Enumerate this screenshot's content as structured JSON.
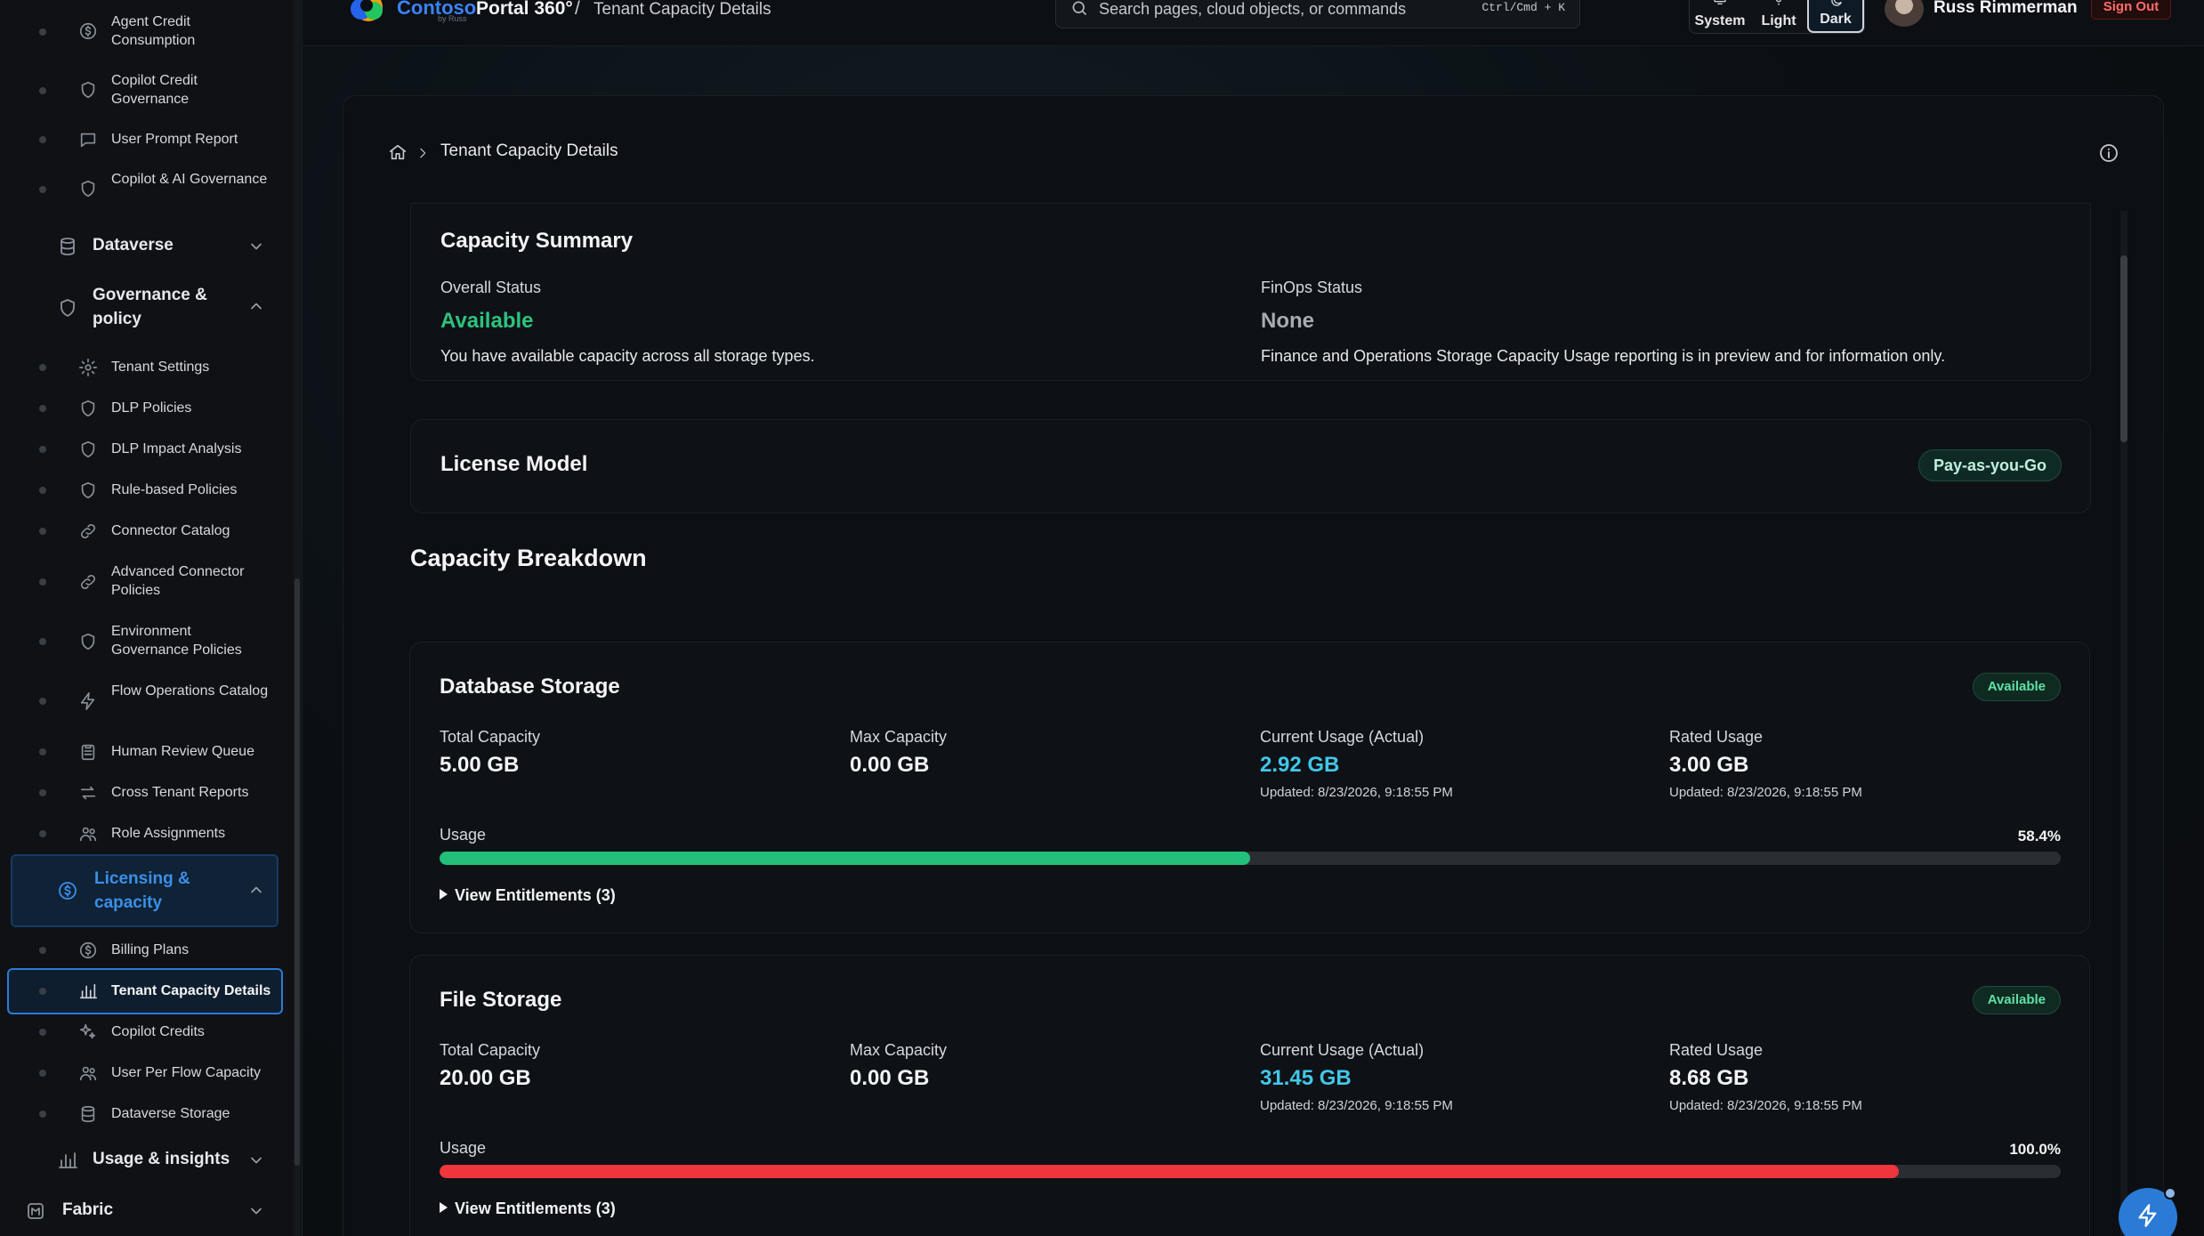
{
  "header": {
    "brand": "Contoso",
    "brand_sub": "by Russ",
    "app_title": "Portal 360°",
    "crumb_sep": "/",
    "page_title": "Tenant Capacity Details",
    "search_placeholder": "Search pages, cloud objects, or commands",
    "search_shortcut": "Ctrl/Cmd + K",
    "theme": {
      "system": "System",
      "light": "Light",
      "dark": "Dark",
      "selected": "Dark"
    },
    "user_name": "Russ Rimmerman",
    "sign_out": "Sign Out"
  },
  "sidebar": {
    "items_top": [
      {
        "label": "Agent Credit Consumption",
        "icon": "dollar-circle-icon"
      },
      {
        "label": "Copilot Credit Governance",
        "icon": "shield-icon"
      },
      {
        "label": "User Prompt Report",
        "icon": "chat-icon"
      },
      {
        "label": "Copilot & AI Governance",
        "icon": "shield-icon"
      }
    ],
    "group_dataverse": "Dataverse",
    "group_governance": "Governance & policy",
    "governance_items": [
      {
        "label": "Tenant Settings",
        "icon": "gear-icon"
      },
      {
        "label": "DLP Policies",
        "icon": "shield-icon"
      },
      {
        "label": "DLP Impact Analysis",
        "icon": "shield-icon"
      },
      {
        "label": "Rule-based Policies",
        "icon": "shield-icon"
      },
      {
        "label": "Connector Catalog",
        "icon": "link-icon"
      },
      {
        "label": "Advanced Connector Policies",
        "icon": "link-icon"
      },
      {
        "label": "Environment Governance Policies",
        "icon": "shield-icon"
      },
      {
        "label": "Flow Operations Catalog",
        "icon": "bolt-icon"
      },
      {
        "label": "Human Review Queue",
        "icon": "clipboard-icon"
      },
      {
        "label": "Cross Tenant Reports",
        "icon": "swap-icon"
      },
      {
        "label": "Role Assignments",
        "icon": "people-icon"
      }
    ],
    "group_licensing": "Licensing & capacity",
    "licensing_items": [
      {
        "label": "Billing Plans",
        "icon": "dollar-circle-icon"
      },
      {
        "label": "Tenant Capacity Details",
        "icon": "bar-chart-icon"
      },
      {
        "label": "Copilot Credits",
        "icon": "sparkle-icon"
      },
      {
        "label": "User Per Flow Capacity",
        "icon": "people-icon"
      },
      {
        "label": "Dataverse Storage",
        "icon": "database-icon"
      }
    ],
    "group_usage": "Usage & insights",
    "group_fabric": "Fabric"
  },
  "breadcrumb": {
    "current": "Tenant Capacity Details"
  },
  "summary": {
    "title": "Capacity Summary",
    "overall_label": "Overall Status",
    "overall_value": "Available",
    "overall_desc": "You have available capacity across all storage types.",
    "finops_label": "FinOps Status",
    "finops_value": "None",
    "finops_desc": "Finance and Operations Storage Capacity Usage reporting is in preview and for information only."
  },
  "license": {
    "title": "License Model",
    "value": "Pay-as-you-Go"
  },
  "breakdown_title": "Capacity Breakdown",
  "storage": [
    {
      "title": "Database Storage",
      "status": "Available",
      "total_label": "Total Capacity",
      "total": "5.00 GB",
      "max_label": "Max Capacity",
      "max": "0.00 GB",
      "current_label": "Current Usage (Actual)",
      "current": "2.92 GB",
      "current_updated": "Updated: 8/23/2026, 9:18:55 PM",
      "rated_label": "Rated Usage",
      "rated": "3.00 GB",
      "rated_updated": "Updated: 8/23/2026, 9:18:55 PM",
      "usage_label": "Usage",
      "usage_pct": "58.4%",
      "usage_fraction": 0.5,
      "bar_color": "#22c07a",
      "entitlements": "View Entitlements (3)"
    },
    {
      "title": "File Storage",
      "status": "Available",
      "total_label": "Total Capacity",
      "total": "20.00 GB",
      "max_label": "Max Capacity",
      "max": "0.00 GB",
      "current_label": "Current Usage (Actual)",
      "current": "31.45 GB",
      "current_updated": "Updated: 8/23/2026, 9:18:55 PM",
      "rated_label": "Rated Usage",
      "rated": "8.68 GB",
      "rated_updated": "Updated: 8/23/2026, 9:18:55 PM",
      "usage_label": "Usage",
      "usage_pct": "100.0%",
      "usage_fraction": 0.9,
      "bar_color": "#f0353d",
      "entitlements": "View Entitlements (3)"
    }
  ]
}
